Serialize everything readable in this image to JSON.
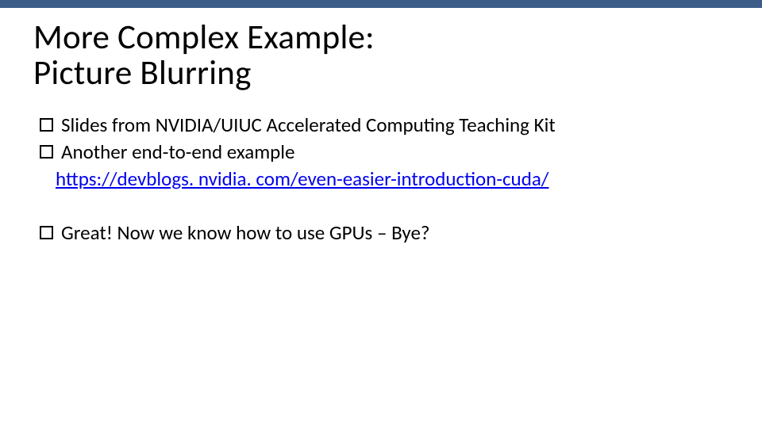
{
  "title_line1": "More Complex Example:",
  "title_line2": "Picture Blurring",
  "bullets": {
    "b1": "Slides from NVIDIA/UIUC Accelerated Computing Teaching Kit",
    "b2": "Another end-to-end example",
    "link": "https://devblogs. nvidia. com/even-easier-introduction-cuda/",
    "b3": "Great! Now we know how to use GPUs – Bye?"
  }
}
